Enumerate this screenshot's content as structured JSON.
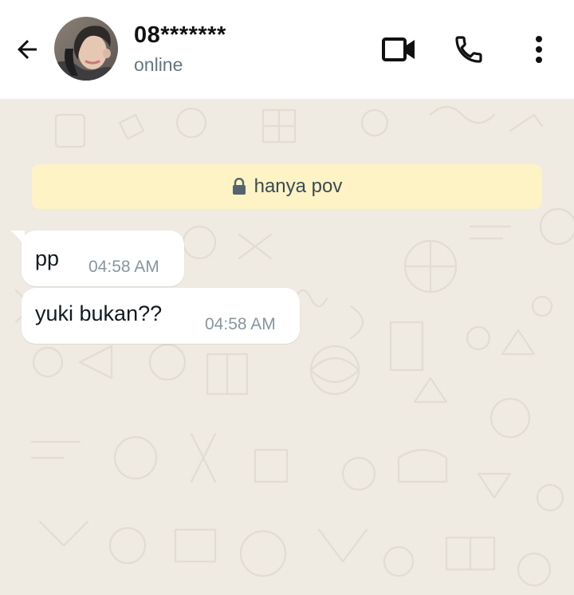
{
  "header": {
    "contact_name": "08*******",
    "status": "online",
    "icons": {
      "back": "arrow-left-icon",
      "video": "video-camera-icon",
      "call": "phone-icon",
      "menu": "more-vertical-icon"
    }
  },
  "chat": {
    "notice": {
      "icon": "lock-icon",
      "text": "hanya pov"
    },
    "messages": [
      {
        "text": "pp",
        "time": "04:58 AM",
        "direction": "incoming"
      },
      {
        "text": "yuki bukan??",
        "time": "04:58 AM",
        "direction": "incoming"
      }
    ]
  },
  "colors": {
    "header_bg": "#ffffff",
    "chat_bg": "#efeae2",
    "notice_bg": "#fdf3c4",
    "bubble_bg": "#ffffff",
    "time_text": "#8696a0",
    "status_text": "#667781"
  }
}
